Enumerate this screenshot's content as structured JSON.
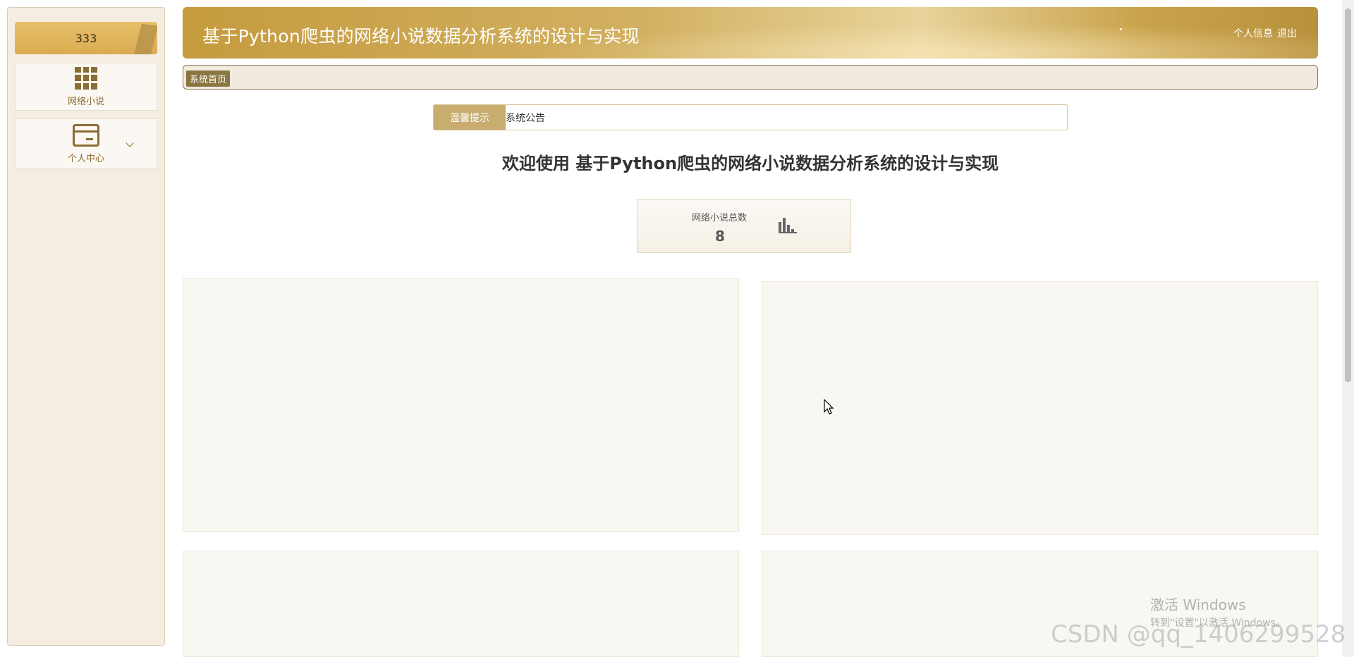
{
  "sidebar": {
    "user_label": "333",
    "items": [
      {
        "label": "网络小说",
        "icon": "grid-icon"
      },
      {
        "label": "个人中心",
        "icon": "card-icon",
        "expandable": true
      }
    ]
  },
  "header": {
    "title": "基于Python爬虫的网络小说数据分析系统的设计与实现",
    "links": {
      "profile": "个人信息",
      "logout": "退出"
    }
  },
  "breadcrumb": {
    "items": [
      "系统首页"
    ]
  },
  "notice": {
    "label": "温馨提示",
    "text": "系统公告"
  },
  "welcome": {
    "text": "欢迎使用 基于Python爬虫的网络小说数据分析系统的设计与实现"
  },
  "stats": [
    {
      "label": "网络小说总数",
      "value": "8",
      "icon": "bar-chart-icon"
    }
  ],
  "watermarks": {
    "windows_line1": "激活 Windows",
    "windows_line2": "转到\"设置\"以激活 Windows。",
    "csdn": "CSDN @qq_1406299528"
  },
  "colors": {
    "accent": "#c9ad6e",
    "header_gold": "#c59b3e",
    "sidebar_bg": "#f5ede2",
    "breadcrumb_active": "#8a7440"
  }
}
